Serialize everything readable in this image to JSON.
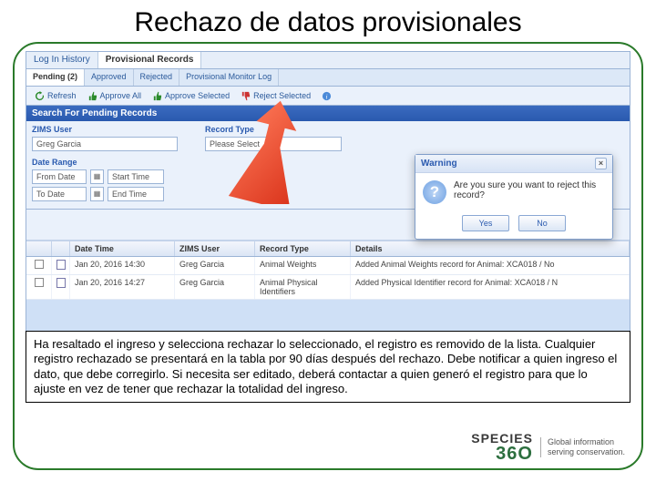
{
  "slide": {
    "title": "Rechazo de datos provisionales"
  },
  "tabs": {
    "login": "Log In History",
    "provisional": "Provisional Records"
  },
  "subtabs": {
    "pending": "Pending (2)",
    "approved": "Approved",
    "rejected": "Rejected",
    "monitorlog": "Provisional Monitor Log"
  },
  "toolbar": {
    "refresh": "Refresh",
    "approve_all": "Approve All",
    "approve_selected": "Approve Selected",
    "reject_selected": "Reject Selected"
  },
  "search": {
    "header": "Search For Pending Records",
    "zims_user_label": "ZIMS User",
    "zims_user_value": "Greg Garcia",
    "record_type_label": "Record Type",
    "record_type_placeholder": "Please Select",
    "date_range_label": "Date Range",
    "from_date": "From Date",
    "start_time": "Start Time",
    "to_date": "To Date",
    "end_time": "End Time"
  },
  "grid": {
    "headers": {
      "datetime": "Date Time",
      "user": "ZIMS User",
      "rtype": "Record Type",
      "details": "Details"
    },
    "rows": [
      {
        "datetime": "Jan 20, 2016 14:30",
        "user": "Greg Garcia",
        "rtype": "Animal Weights",
        "details": "Added Animal Weights record for Animal: XCA018 / No"
      },
      {
        "datetime": "Jan 20, 2016 14:27",
        "user": "Greg Garcia",
        "rtype": "Animal Physical Identifiers",
        "details": "Added Physical Identifier record for Animal: XCA018 / N"
      }
    ]
  },
  "dialog": {
    "title": "Warning",
    "message": "Are you sure you want to reject this record?",
    "yes": "Yes",
    "no": "No"
  },
  "caption": "Ha resaltado el ingreso y selecciona rechazar lo seleccionado, el registro es removido de la lista. Cualquier registro rechazado se presentará en la tabla por 90 días después del rechazo.  Debe notificar a quien ingreso el dato, que debe corregirlo. Si necesita ser editado, deberá contactar a quien generó el registro para que lo ajuste en vez de tener que rechazar la totalidad del ingreso.",
  "brand": {
    "name_top": "SPECIES",
    "name_bottom": "36O",
    "tag1": "Global information",
    "tag2": "serving conservation."
  }
}
